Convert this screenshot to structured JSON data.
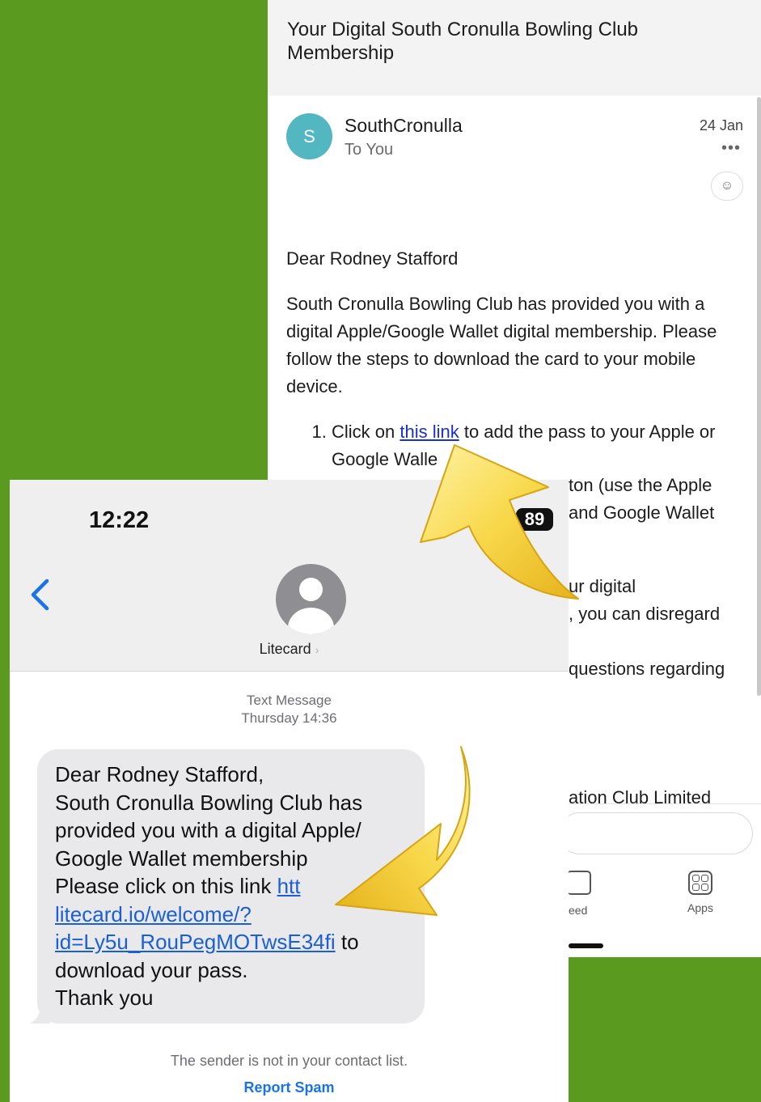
{
  "email": {
    "subject": "Your Digital South Cronulla Bowling Club Membership",
    "sender_initial": "S",
    "sender_name": "SouthCronulla",
    "recipient": "To You",
    "date": "24 Jan",
    "more": "•••",
    "reaction_icon": "☺",
    "greeting": "Dear Rodney Stafford",
    "intro": "South Cronulla Bowling Club has provided you with a digital Apple/Google Wallet digital membership. Please follow the steps to download the card to your mobile device.",
    "step1_prefix": "Click on ",
    "step1_link": "this link",
    "step1_suffix": " to add the pass to your Apple or Google Walle",
    "frag1": "ton (use the Apple",
    "frag2": "and Google Wallet",
    "frag3": "ur digital",
    "frag4": ", you can disregard",
    "frag5": "questions regarding",
    "frag6": "ation Club Limited",
    "tab_feed": "eed",
    "tab_apps": "Apps"
  },
  "phone": {
    "time": "12:22",
    "battery": "89",
    "contact_name": "Litecard",
    "meta_type": "Text Message",
    "meta_time": "Thursday 14:36",
    "msg_line1": "Dear Rodney Stafford,",
    "msg_line2": "South Cronulla Bowling Club has provided you with a digital Apple/ Google Wallet membership",
    "msg_line3_prefix": "Please click on this link ",
    "msg_link": "https://litecard.io/welcome/?id=Ly5u_RouPegMOTwsE34fi",
    "msg_link_l1": "htt",
    "msg_link_l2": "litecard.io/welcome/?",
    "msg_link_l3": "id=Ly5u_RouPegMOTwsE34fi",
    "msg_line3_suffix": " to download your pass.",
    "msg_line4": "Thank you",
    "sender_note": "The sender is not in your contact list.",
    "report_spam": "Report Spam"
  },
  "colors": {
    "background": "#5a9a1e",
    "email_avatar": "#53b7c2",
    "link_blue": "#1a2fdc",
    "ios_blue": "#1a73e8",
    "bubble_gray": "#e9e9eb",
    "arrow_yellow": "#f7d23a"
  }
}
